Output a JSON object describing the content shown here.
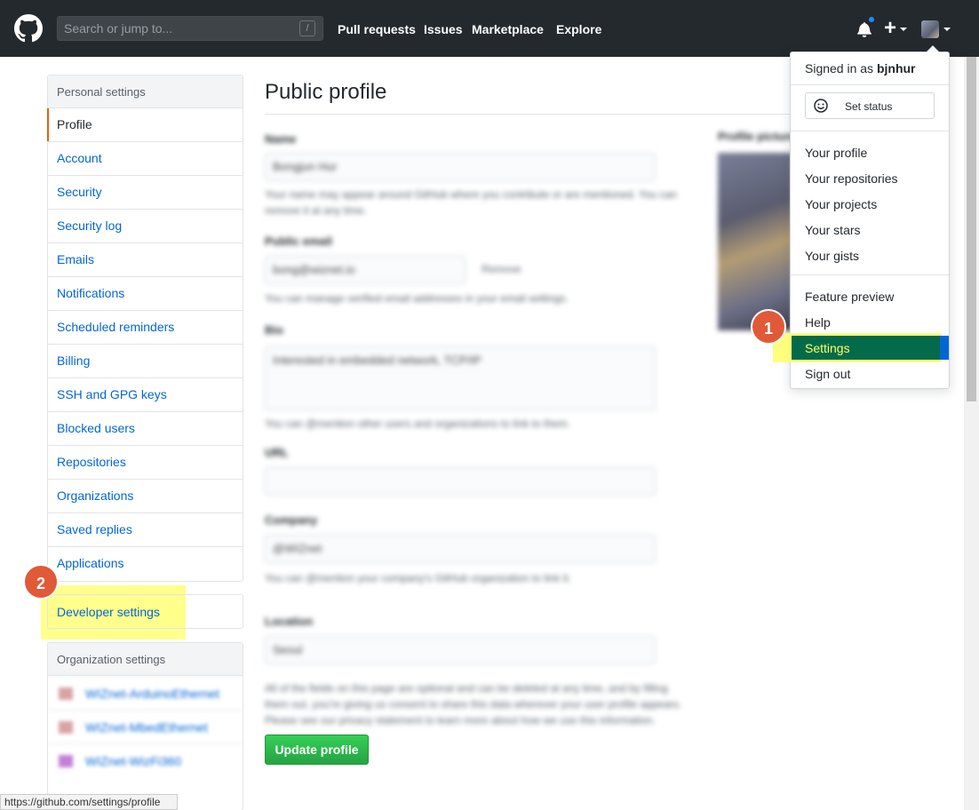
{
  "header": {
    "search_placeholder": "Search or jump to...",
    "slash_key": "/",
    "nav": [
      "Pull requests",
      "Issues",
      "Marketplace",
      "Explore"
    ]
  },
  "sidebar": {
    "heading": "Personal settings",
    "items": [
      {
        "label": "Profile",
        "selected": true
      },
      {
        "label": "Account"
      },
      {
        "label": "Security"
      },
      {
        "label": "Security log"
      },
      {
        "label": "Emails"
      },
      {
        "label": "Notifications"
      },
      {
        "label": "Scheduled reminders"
      },
      {
        "label": "Billing"
      },
      {
        "label": "SSH and GPG keys"
      },
      {
        "label": "Blocked users"
      },
      {
        "label": "Repositories"
      },
      {
        "label": "Organizations"
      },
      {
        "label": "Saved replies"
      },
      {
        "label": "Applications"
      }
    ],
    "developer_settings": "Developer settings",
    "org_heading": "Organization settings",
    "orgs": [
      "WIZnet-ArduinoEthernet",
      "WIZnet-MbedEthernet",
      "WIZnet-WizFi360"
    ]
  },
  "main": {
    "title": "Public profile",
    "form": {
      "name_label": "Name",
      "name_value": "Bongjun Hur",
      "name_note": "Your name may appear around GitHub where you contribute or are mentioned. You can remove it at any time.",
      "email_label": "Public email",
      "email_value": "bong@wiznet.io",
      "email_remove": "Remove",
      "email_note": "You can manage verified email addresses in your email settings.",
      "bio_label": "Bio",
      "bio_value": "Interested in embedded network, TCP/IP",
      "bio_note": "You can @mention other users and organizations to link to them.",
      "url_label": "URL",
      "company_label": "Company",
      "company_value": "@WIZnet",
      "company_note": "You can @mention your company's GitHub organization to link it.",
      "location_label": "Location",
      "location_value": "Seoul",
      "footer_note": "All of the fields on this page are optional and can be deleted at any time, and by filling them out, you're giving us consent to share this data wherever your user profile appears. Please see our privacy statement to learn more about how we use this information."
    },
    "picture_label": "Profile picture",
    "update_button": "Update profile"
  },
  "dropdown": {
    "signed_in_prefix": "Signed in as",
    "username": "bjnhur",
    "set_status": "Set status",
    "group1": [
      "Your profile",
      "Your repositories",
      "Your projects",
      "Your stars",
      "Your gists"
    ],
    "group2": [
      "Feature preview",
      "Help"
    ],
    "settings": "Settings",
    "sign_out": "Sign out"
  },
  "annotations": {
    "badge1": "1",
    "badge2": "2"
  },
  "statusbar": {
    "url": "https://github.com/settings/profile"
  },
  "colors": {
    "header_bg": "#24292e",
    "link": "#0366d6",
    "highlight": "#ffff66",
    "badge": "#e05a37",
    "button_green": "#28a745"
  }
}
